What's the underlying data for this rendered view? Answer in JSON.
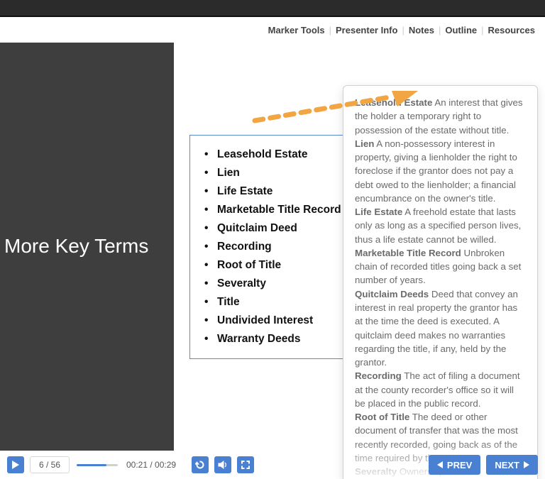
{
  "tabs": {
    "marker": "Marker Tools",
    "presenter": "Presenter Info",
    "notes": "Notes",
    "outline": "Outline",
    "resources": "Resources"
  },
  "slide": {
    "title": "More Key Terms",
    "terms": [
      "Leasehold Estate",
      "Lien",
      "Life Estate",
      "Marketable Title Record",
      "Quitclaim Deed",
      "Recording",
      "Root of Title",
      "Severalty",
      "Title",
      "Undivided Interest",
      "Warranty Deeds"
    ]
  },
  "notes": {
    "defs": [
      {
        "term": "Leasehold Estate",
        "text": "An interest that gives the holder a temporary right to possession of the estate without title."
      },
      {
        "term": "Lien",
        "text": "A non-possessory interest in property, giving a lienholder the right to foreclose if the grantor does not pay a debt owed to the lienholder; a financial encumbrance on the owner's title."
      },
      {
        "term": "Life Estate",
        "text": "A freehold estate that lasts only as long as a specified person lives, thus a life estate cannot be willed."
      },
      {
        "term": "Marketable Title Record",
        "text": "Unbroken chain of recorded titles going back a set number of years."
      },
      {
        "term": "Quitclaim Deeds",
        "text": "Deed that convey an interest in real property the grantor has at the time the deed is executed. A quitclaim deed makes no warranties regarding the title, if any, held by the grantor."
      },
      {
        "term": "Recording",
        "text": "The act of filing a document at the county recorder's office so it will be placed in the public record."
      },
      {
        "term": "Root of Title",
        "text": "The deed or other document of transfer that was the most recently recorded, going back as of the time required by the state."
      },
      {
        "term": "Severalty",
        "text": "Ownership of real"
      }
    ]
  },
  "controls": {
    "slide_index": "6 / 56",
    "time": "00:21 / 00:29",
    "progress_pct": 72,
    "prev": "PREV",
    "next": "NEXT"
  },
  "colors": {
    "accent": "#4a80d1",
    "arrow": "#f2a543"
  }
}
